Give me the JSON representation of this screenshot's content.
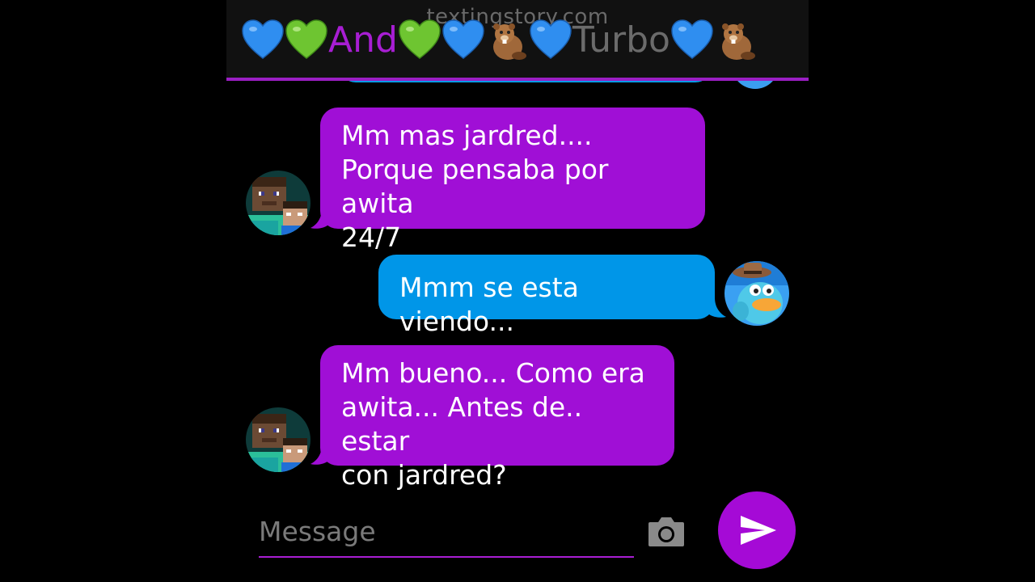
{
  "header": {
    "watermark": "textingstory.com",
    "name_and": "And",
    "name_turbo": "Turbo"
  },
  "messages": [
    {
      "sender": "And",
      "side": "left",
      "color": "#a00fd6",
      "text": "Mm mas jardred....\nPorque pensaba por awita\n24/7"
    },
    {
      "sender": "Turbo",
      "side": "right",
      "color": "#0096e8",
      "text": "Mmm se esta viendo..."
    },
    {
      "sender": "And",
      "side": "left",
      "color": "#a00fd6",
      "text": "Mm bueno... Como era\nawita... Antes de.. estar\ncon jardred?"
    }
  ],
  "composer": {
    "placeholder": "Message"
  },
  "colors": {
    "accent": "#a81ed3",
    "blue_bubble": "#0096e8",
    "purple_bubble": "#a00fd6"
  },
  "icons": [
    "blue-heart-icon",
    "green-heart-icon",
    "beaver-icon",
    "camera-icon",
    "send-icon"
  ]
}
